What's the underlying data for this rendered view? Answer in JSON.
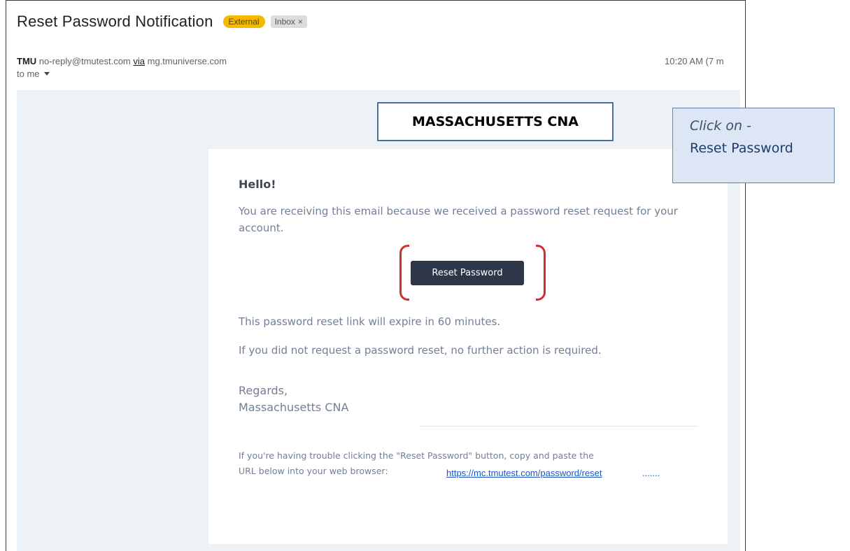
{
  "email": {
    "subject": "Reset Password Notification",
    "labels": {
      "external": "External",
      "inbox": "Inbox",
      "inbox_close": "×"
    },
    "sender": {
      "name": "TMU",
      "address": "no-reply@tmutest.com",
      "via_word": "via",
      "via_domain": "mg.tmuniverse.com"
    },
    "recipient_label": "to me",
    "time": "10:20 AM (7 m"
  },
  "message": {
    "brand_banner": "MASSACHUSETTS CNA",
    "greeting": "Hello!",
    "intro": "You are receiving this email because we received a password reset request for your account.",
    "button_label": "Reset Password",
    "expiry": "This password reset link will expire in 60 minutes.",
    "no_action": "If you did not request a password reset, no further action is required.",
    "regards": "Regards,",
    "signature": "Massachusetts CNA",
    "trouble_text": "If you're having trouble clicking the \"Reset Password\" button, copy and paste the",
    "url_prefix": "URL below into your web browser:",
    "url": "https://mc.tmutest.com/password/reset",
    "url_suffix": "......."
  },
  "annotation": {
    "line1": "Click on -",
    "line2": "Reset Password",
    "highlight_color": "#d0312d"
  },
  "colors": {
    "external_badge": "#f5b900",
    "button_bg": "#2d3748",
    "body_bg": "#edf2f7",
    "callout_bg": "#dde6f5",
    "link": "#1a56c4"
  }
}
